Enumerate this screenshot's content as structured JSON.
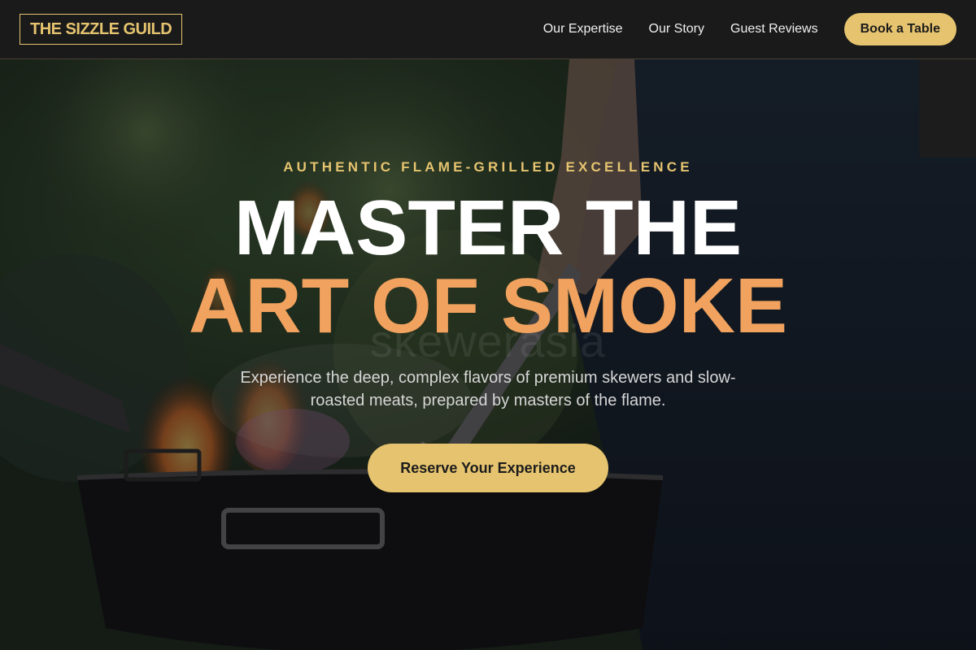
{
  "nav": {
    "logo": "THE SIZZLE GUILD",
    "links": [
      "Our Expertise",
      "Our Story",
      "Guest Reviews"
    ],
    "book_label": "Book a Table"
  },
  "hero": {
    "eyebrow": "AUTHENTIC FLAME-GRILLED EXCELLENCE",
    "headline_line1": "MASTER THE",
    "headline_line2": "ART OF SMOKE",
    "watermark": "skewerasia",
    "subcopy": "Experience the deep, complex flavors of premium skewers and slow-roasted meats, prepared by masters of the flame.",
    "cta_label": "Reserve Your Experience"
  },
  "colors": {
    "accent_gold": "#e6c46f",
    "accent_orange": "#f0a25e",
    "nav_bg": "#1a1a1b"
  }
}
